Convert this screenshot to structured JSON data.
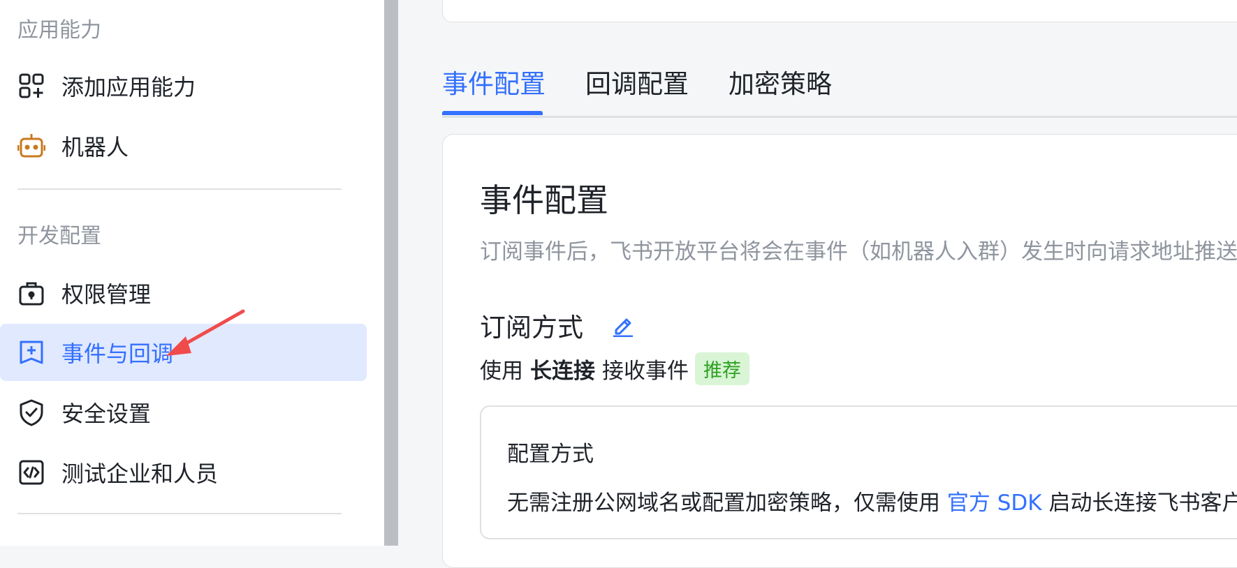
{
  "sidebar": {
    "section_app": "应用能力",
    "section_dev": "开发配置",
    "items": [
      {
        "label": "添加应用能力",
        "icon": "apps-add-icon"
      },
      {
        "label": "机器人",
        "icon": "robot-icon"
      },
      {
        "label": "权限管理",
        "icon": "briefcase-lock-icon"
      },
      {
        "label": "事件与回调",
        "icon": "event-plus-icon",
        "active": true
      },
      {
        "label": "安全设置",
        "icon": "shield-check-icon"
      },
      {
        "label": "测试企业和人员",
        "icon": "code-box-icon"
      }
    ]
  },
  "tabs": [
    {
      "label": "事件配置",
      "active": true
    },
    {
      "label": "回调配置"
    },
    {
      "label": "加密策略"
    }
  ],
  "card": {
    "title": "事件配置",
    "description": "订阅事件后，飞书开放平台将会在事件（如机器人入群）发生时向请求地址推送",
    "subscription_title": "订阅方式",
    "mode_prefix": "使用",
    "mode_bold": "长连接",
    "mode_suffix": "接收事件",
    "badge": "推荐",
    "config_title": "配置方式",
    "config_desc_prefix": "无需注册公网域名或配置加密策略，仅需使用",
    "config_link": "官方 SDK",
    "config_desc_suffix": "启动长连接飞书客户端"
  },
  "colors": {
    "accent": "#3370ff",
    "active_bg": "#e1e9ff",
    "badge_bg": "#d9f5d6",
    "badge_fg": "#2ea121",
    "robot": "#c9781f",
    "arrow": "#f04b4b"
  }
}
